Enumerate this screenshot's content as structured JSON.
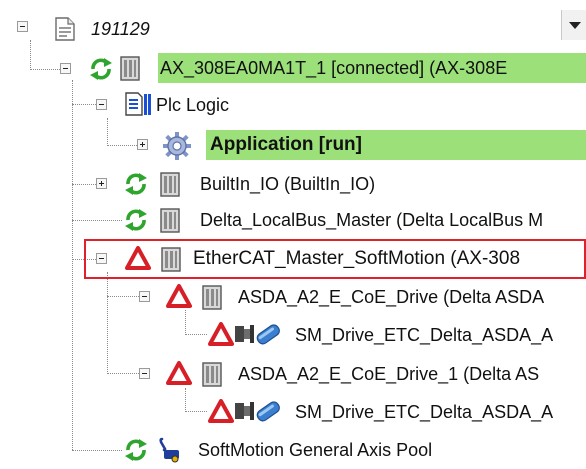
{
  "project": {
    "name": "191129"
  },
  "tree": {
    "device_label": "AX_308EA0MA1T_1 [connected] (AX-308E",
    "plc_logic_label": "Plc Logic",
    "application_label": "Application [run]",
    "builtin_io_label": "BuiltIn_IO (BuiltIn_IO)",
    "local_bus_label": "Delta_LocalBus_Master (Delta LocalBus M",
    "ethercat_master_label": "EtherCAT_Master_SoftMotion (AX-308",
    "drive_1_label": "ASDA_A2_E_CoE_Drive (Delta ASDA",
    "drive_1_axis_label": "SM_Drive_ETC_Delta_ASDA_A",
    "drive_2_label": "ASDA_A2_E_CoE_Drive_1 (Delta AS",
    "drive_2_axis_label": "SM_Drive_ETC_Delta_ASDA_A",
    "axis_pool_label": "SoftMotion General Axis Pool"
  },
  "colors": {
    "running_bg": "#9ce07a",
    "sync_icon": "#2fa52f",
    "warning": "#d61f26",
    "highlight_border": "#e0202a"
  },
  "icons": {
    "project": "document-icon",
    "sync": "sync-icon",
    "device": "device-icon",
    "warning": "warning-icon",
    "plc": "plc-logic-icon",
    "application": "gear-icon",
    "axis": "axis-icon",
    "pool": "axis-pool-icon"
  }
}
